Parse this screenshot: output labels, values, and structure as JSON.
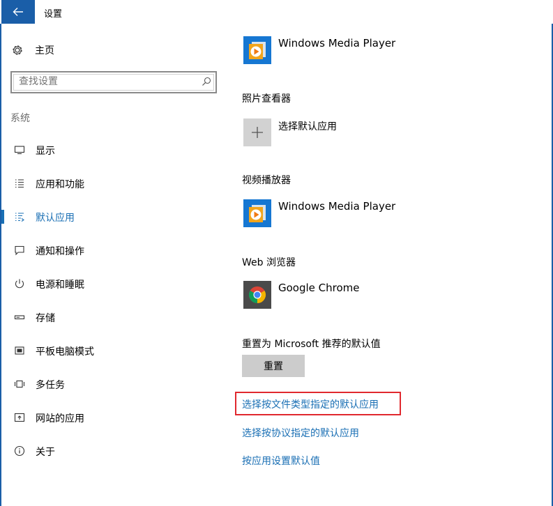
{
  "window": {
    "title": "设置"
  },
  "sidebar": {
    "home_label": "主页",
    "search": {
      "placeholder": "查找设置"
    },
    "section": "系统",
    "items": [
      {
        "label": "显示",
        "icon": "display-icon",
        "active": false
      },
      {
        "label": "应用和功能",
        "icon": "apps-list-icon",
        "active": false
      },
      {
        "label": "默认应用",
        "icon": "default-apps-icon",
        "active": true
      },
      {
        "label": "通知和操作",
        "icon": "notification-icon",
        "active": false
      },
      {
        "label": "电源和睡眠",
        "icon": "power-icon",
        "active": false
      },
      {
        "label": "存储",
        "icon": "storage-icon",
        "active": false
      },
      {
        "label": "平板电脑模式",
        "icon": "tablet-mode-icon",
        "active": false
      },
      {
        "label": "多任务",
        "icon": "multitask-icon",
        "active": false
      },
      {
        "label": "网站的应用",
        "icon": "web-apps-icon",
        "active": false
      },
      {
        "label": "关于",
        "icon": "info-icon",
        "active": false
      }
    ]
  },
  "main": {
    "music_app": {
      "name": "Windows Media Player",
      "icon": "windows-media-player-icon"
    },
    "photo_viewer": {
      "heading": "照片查看器",
      "app": "选择默认应用",
      "icon": "plus-icon"
    },
    "video_player": {
      "heading": "视频播放器",
      "app": "Windows Media Player",
      "icon": "windows-media-player-icon"
    },
    "web_browser": {
      "heading": "Web 浏览器",
      "app": "Google Chrome",
      "icon": "chrome-icon"
    },
    "reset": {
      "heading": "重置为 Microsoft 推荐的默认值",
      "button": "重置"
    },
    "links": [
      "选择按文件类型指定的默认应用",
      "选择按协议指定的默认应用",
      "按应用设置默认值"
    ]
  },
  "colors": {
    "accent": "#1a5ea8",
    "link": "#1a6fb4",
    "highlight": "#e0282e",
    "button": "#cccccc"
  }
}
